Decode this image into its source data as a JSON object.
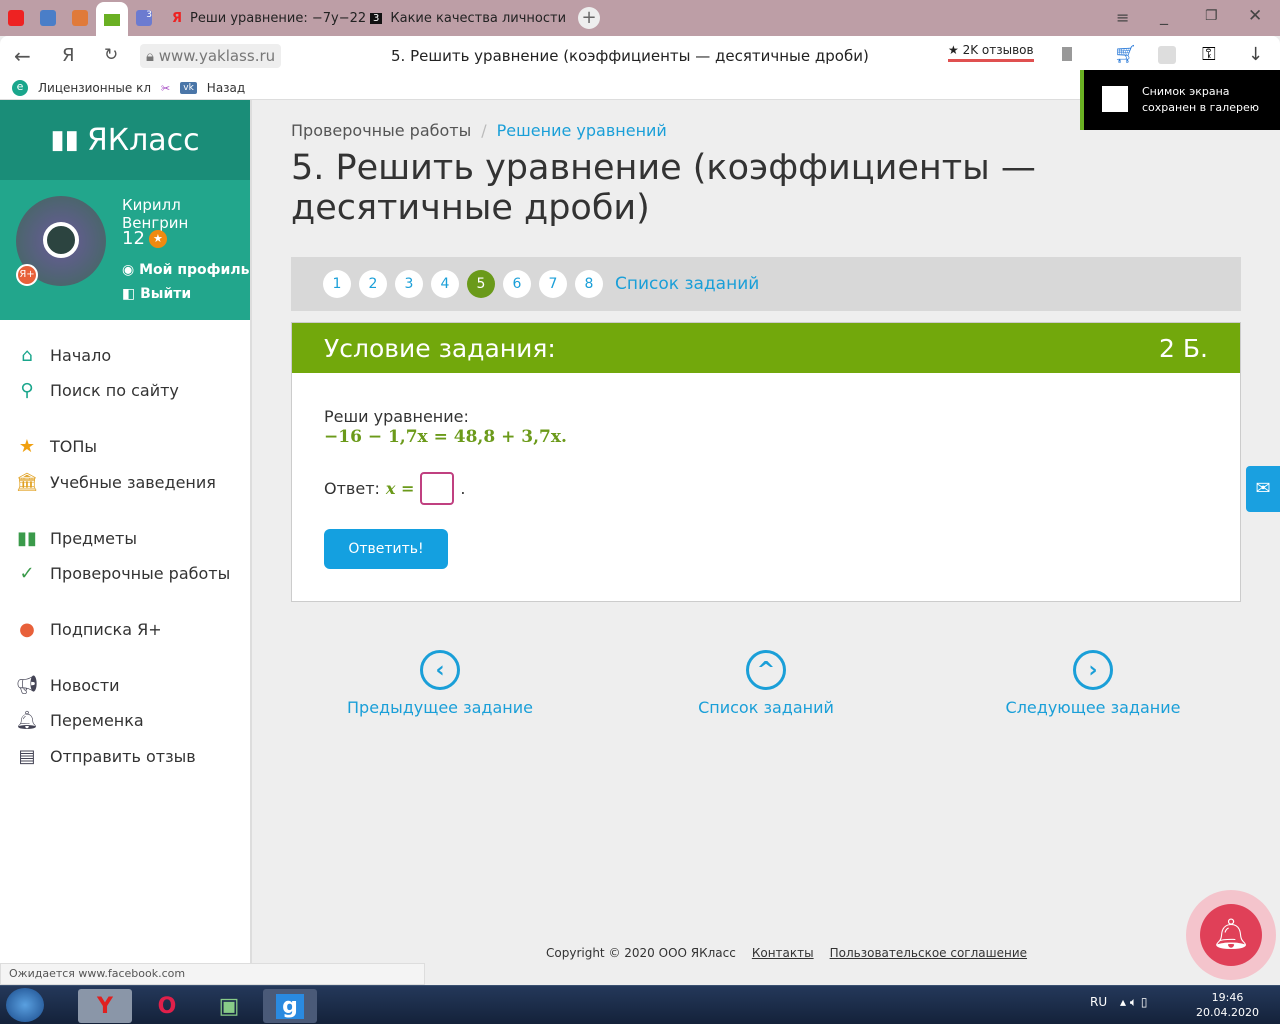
{
  "browser": {
    "tabs": [
      {
        "label": "Реши уравнение: −7y−22"
      },
      {
        "label": "Какие качества личности"
      }
    ],
    "tab_badge": "3",
    "url": "www.yaklass.ru",
    "page_title": "5. Решить уравнение (коэффициенты — десятичные дроби)",
    "reviews": "★ 2K отзывов",
    "bookmarks": [
      "Лицензионные кл",
      "Назад"
    ],
    "notification": "Снимок экрана сохранен в галерею",
    "status": "Ожидается www.facebook.com"
  },
  "sidebar": {
    "logo": "ЯКласс",
    "user": "Кирилл Венгрин",
    "points": "12",
    "profile": "Мой профиль",
    "logout": "Выйти",
    "items": [
      {
        "label": "Начало",
        "icon": "home-icon"
      },
      {
        "label": "Поиск по сайту",
        "icon": "search-icon"
      },
      {
        "label": "ТОПы",
        "icon": "star-icon"
      },
      {
        "label": "Учебные заведения",
        "icon": "school-icon"
      },
      {
        "label": "Предметы",
        "icon": "book-icon"
      },
      {
        "label": "Проверочные работы",
        "icon": "check-icon"
      },
      {
        "label": "Подписка Я+",
        "icon": "subscription-icon"
      },
      {
        "label": "Новости",
        "icon": "news-icon"
      },
      {
        "label": "Переменка",
        "icon": "bell-icon"
      },
      {
        "label": "Отправить отзыв",
        "icon": "feedback-icon"
      }
    ]
  },
  "main": {
    "breadcrumb": [
      "Проверочные работы",
      "Решение уравнений"
    ],
    "title": "5. Решить уравнение (коэффициенты — десятичные дроби)",
    "pages": [
      "1",
      "2",
      "3",
      "4",
      "5",
      "6",
      "7",
      "8"
    ],
    "current_page": "5",
    "task_list": "Список заданий",
    "condition_header": "Условие задания:",
    "score": "2 Б.",
    "prompt": "Реши уравнение:",
    "equation": "−16 − 1,7x = 48,8 + 3,7x.",
    "answer_label": "Ответ:",
    "answer_var": "x =",
    "answer_value": "",
    "submit": "Ответить!",
    "prev": "Предыдущее задание",
    "list": "Список заданий",
    "next": "Следующее задание"
  },
  "footer": {
    "copyright": "Copyright © 2020 ООО ЯКласс",
    "contacts": "Контакты",
    "agreement": "Пользовательское соглашение"
  },
  "taskbar": {
    "lang": "RU",
    "time": "19:46",
    "date": "20.04.2020"
  }
}
